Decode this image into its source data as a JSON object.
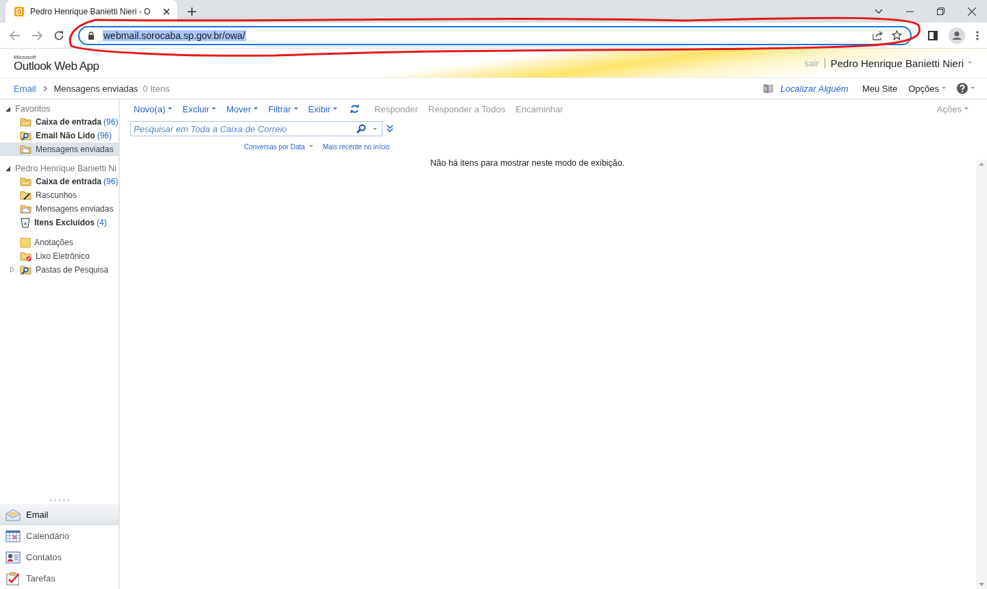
{
  "browser": {
    "tab_title": "Pedro Henrique Banietti Nieri - O",
    "url": "webmail.sorocaba.sp.gov.br/owa/"
  },
  "header": {
    "logo_small": "Microsoft",
    "logo": "Outlook Web App",
    "signout": "sair",
    "user": "Pedro Henrique Banietti Nieri"
  },
  "breadcrumb": {
    "root": "Email",
    "folder": "Mensagens enviadas",
    "count": "0 Itens"
  },
  "top_links": [
    {
      "kind": "find",
      "label": "Localizar Alguém"
    },
    {
      "kind": "plain",
      "label": "Meu Site"
    },
    {
      "kind": "menu",
      "label": "Opções"
    }
  ],
  "sidebar": {
    "favorites": {
      "label": "Favoritos",
      "expanded": true,
      "items": [
        {
          "kind": "inbox",
          "label": "Caixa de entrada",
          "count": "(96)",
          "selected": false
        },
        {
          "kind": "search",
          "label": "Email Não Lido",
          "count": "(96)",
          "selected": false
        },
        {
          "kind": "sent",
          "label": "Mensagens enviadas",
          "selected": true
        }
      ]
    },
    "mailbox": {
      "label": "Pedro Henrique Banietti Ni",
      "expanded": true,
      "items": [
        {
          "kind": "inbox",
          "label": "Caixa de entrada",
          "count": "(96)",
          "selected": false
        },
        {
          "kind": "drafts",
          "label": "Rascunhos",
          "selected": false
        },
        {
          "kind": "sent",
          "label": "Mensagens enviadas",
          "selected": false
        },
        {
          "kind": "deleted",
          "label": "Itens Excluídos",
          "count": "(4)",
          "selected": false
        },
        {
          "kind": "gap"
        },
        {
          "kind": "notes",
          "label": "Anotações",
          "selected": false
        },
        {
          "kind": "junk",
          "label": "Lixo Eletrônico",
          "selected": false
        },
        {
          "kind": "search",
          "label": "Pastas de Pesquisa",
          "selected": false,
          "expanded": false
        }
      ]
    },
    "modules": [
      {
        "kind": "mail",
        "label": "Email",
        "selected": true
      },
      {
        "kind": "calendar",
        "label": "Calendário",
        "selected": false
      },
      {
        "kind": "contacts",
        "label": "Contatos",
        "selected": false
      },
      {
        "kind": "tasks",
        "label": "Tarefas",
        "selected": false
      }
    ]
  },
  "toolbar": [
    {
      "label": "Novo(a)",
      "menu": true,
      "disabled": false
    },
    {
      "label": "Excluir",
      "menu": true,
      "disabled": false
    },
    {
      "label": "Mover",
      "menu": true,
      "disabled": false
    },
    {
      "label": "Filtrar",
      "menu": true,
      "disabled": false
    },
    {
      "label": "Exibir",
      "menu": true,
      "disabled": false
    },
    {
      "kind": "refresh"
    },
    {
      "label": "Responder",
      "menu": false,
      "disabled": true
    },
    {
      "label": "Responder a Todos",
      "menu": false,
      "disabled": true
    },
    {
      "label": "Encaminhar",
      "menu": false,
      "disabled": true
    }
  ],
  "actions": {
    "label": "Ações",
    "disabled": true
  },
  "search": {
    "placeholder": "Pesquisar em Toda a Caixa de Correio"
  },
  "sort": {
    "arrange": "Conversas por Data",
    "order": "Mais recente no início"
  },
  "empty_message": "Não há itens para mostrar neste modo de exibição."
}
